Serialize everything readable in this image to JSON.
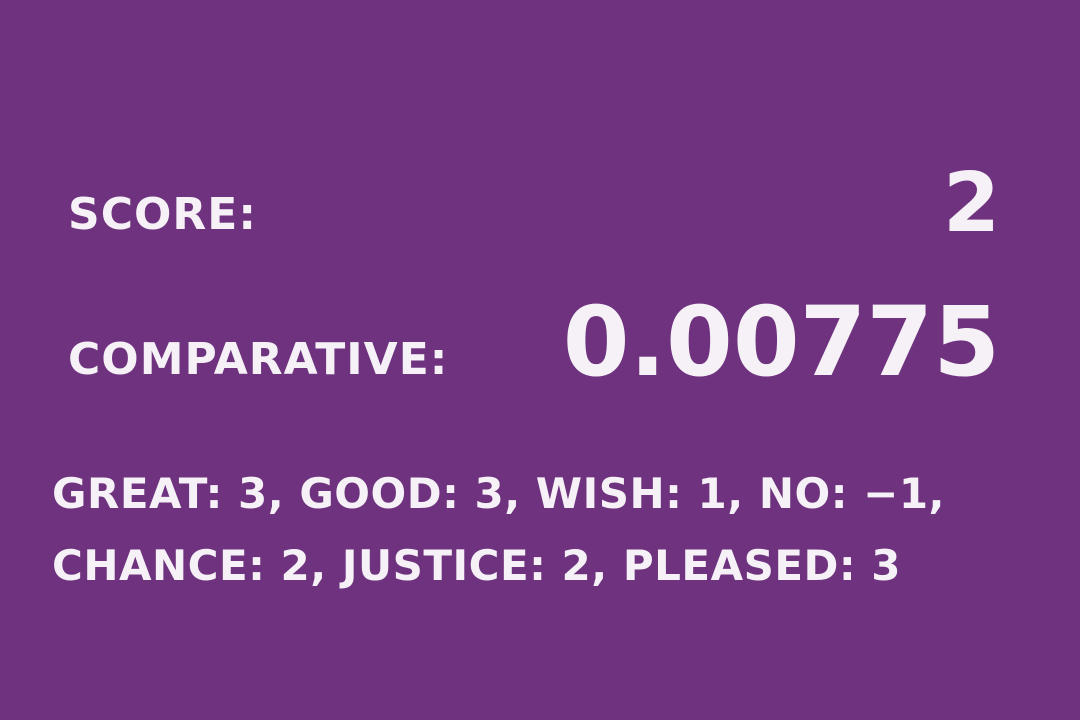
{
  "score": {
    "label": "SCORE:",
    "value": "2"
  },
  "comparative": {
    "label": "COMPARATIVE:",
    "value": "0.00775"
  },
  "words": {
    "line1": "GREAT: 3, GOOD: 3, WISH: 1, NO: −1,",
    "line2": "CHANCE: 2, JUSTICE: 2, PLEASED: 3"
  },
  "colors": {
    "background": "#6e327e",
    "text": "#f5f1f7"
  }
}
